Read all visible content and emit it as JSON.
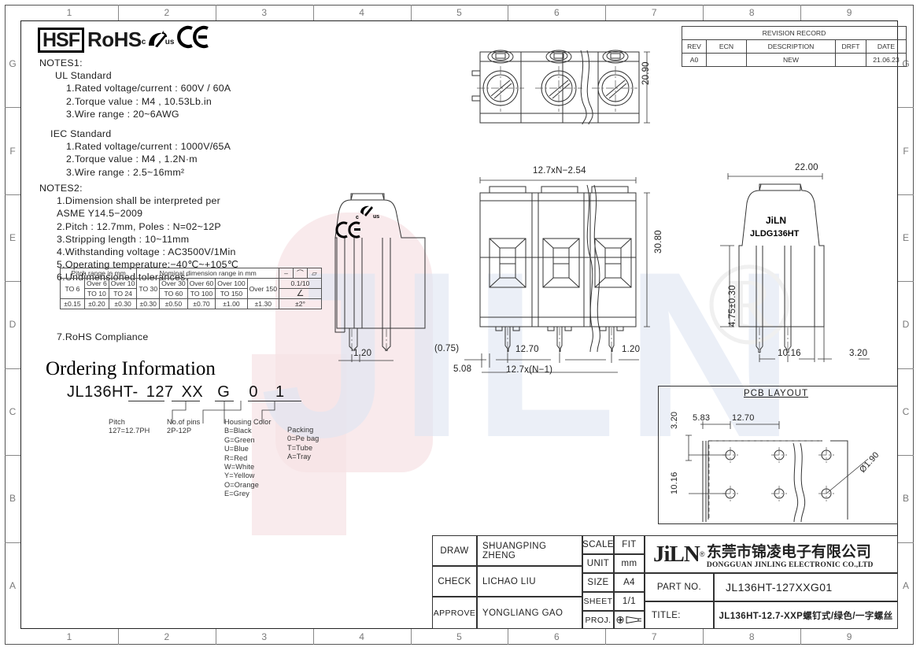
{
  "sheet": {
    "zones_top": [
      "1",
      "2",
      "3",
      "4",
      "5",
      "6",
      "7",
      "8",
      "9"
    ],
    "zones_bottom": [
      "1",
      "2",
      "3",
      "4",
      "5",
      "6",
      "7",
      "8",
      "9"
    ],
    "zones_left": [
      "G",
      "F",
      "E",
      "D",
      "C",
      "B",
      "A"
    ],
    "zones_right": [
      "G",
      "F",
      "E",
      "D",
      "C",
      "B",
      "A"
    ]
  },
  "compliance": {
    "hsf": "HSF",
    "rohs": "RoHS",
    "ul_c": "c",
    "ul_us": "us",
    "ce": "CE"
  },
  "notes1": {
    "heading": "NOTES1:",
    "groups": [
      {
        "title": "UL Standard",
        "items": [
          "1.Rated voltage/current : 600V / 60A",
          "2.Torque value : M4 , 10.53Lb.in",
          "3.Wire range : 20~6AWG"
        ]
      },
      {
        "title": "IEC Standard",
        "items": [
          "1.Rated voltage/current : 1000V/65A",
          "2.Torque value : M4 , 1.2N·m",
          "3.Wire range : 2.5~16mm²"
        ]
      }
    ]
  },
  "notes2": {
    "heading": "NOTES2:",
    "items": [
      "1.Dimension shall be interpreted per",
      "  ASME Y14.5−2009",
      "2.Pitch : 12.7mm, Poles : N=02~12P",
      "3.Stripping length : 10~11mm",
      "4.Withstanding voltage : AC3500V/1Min",
      "5.Operating temperature:−40℃~+105℃",
      "6.Undimensioned tolerances:"
    ],
    "item7": "7.RoHS Compliance"
  },
  "tolerance_table": {
    "header_pitch": "Pitch range in mm",
    "header_nominal": "Nominal dimension range in mm",
    "sym_dash": "–",
    "sym_arc": "⌒",
    "sym_par": "▱",
    "row2": [
      "",
      "Over 6",
      "Over 10",
      "",
      "Over 30",
      "Over 60",
      "Over 100",
      "Over 150"
    ],
    "row3": [
      "TO 6",
      "TO 10",
      "TO 24",
      "TO 30",
      "TO 60",
      "TO 100",
      "TO 150",
      ""
    ],
    "row4": [
      "±0.15",
      "±0.20",
      "±0.30",
      "±0.30",
      "±0.50",
      "±0.70",
      "±1.00",
      "±1.30"
    ],
    "right_top": "0.1/10",
    "right_mid": "∠",
    "right_bot": "±2°"
  },
  "ordering": {
    "title": "Ordering Information",
    "code_parts": [
      "JL136HT-",
      "127",
      "XX",
      "G",
      "0",
      "1"
    ],
    "legends": [
      {
        "name": "pitch",
        "lines": [
          "Pitch",
          "127=12.7PH"
        ]
      },
      {
        "name": "pins",
        "lines": [
          "No.of  pins",
          "2P-12P"
        ]
      },
      {
        "name": "housing-color",
        "lines": [
          "Housing Color",
          "B=Black",
          "G=Green",
          "U=Blue",
          "R=Red",
          "W=White",
          "Y=Yellow",
          "O=Orange",
          "E=Grey"
        ]
      },
      {
        "name": "packing",
        "lines": [
          "Packing",
          "0=Pe bag",
          "T=Tube",
          "A=Tray"
        ]
      }
    ]
  },
  "revision": {
    "title": "REVISION RECORD",
    "columns": [
      "REV",
      "ECN",
      "DESCRIPTION",
      "DRFT",
      "DATE"
    ],
    "rows": [
      [
        "A0",
        "",
        "NEW",
        "",
        "21.06.23"
      ]
    ]
  },
  "views": {
    "top_view": {
      "height_dim": "20.90"
    },
    "front_view": {
      "width_dim": "12.7xN−2.54",
      "height_dim": "30.80",
      "d_075": "(0.75)",
      "d_508": "5.08",
      "d_1270": "12.70",
      "d_pitch_n": "12.7x(N−1)",
      "d_120": "1.20"
    },
    "side_view_left": {
      "d_120": "1.20"
    },
    "side_view_right": {
      "width_dim": "22.00",
      "brand": "JiLN",
      "model": "JLDG136HT",
      "pin_len": "4.75±0.30",
      "d_1016": "10.16",
      "d_320": "3.20"
    },
    "pcb_layout": {
      "title": "PCB LAYOUT",
      "d_320": "3.20",
      "d_583": "5.83",
      "d_1270": "12.70",
      "d_1016": "10.16",
      "hole_dia": "Ø1.90"
    }
  },
  "title_block": {
    "draw_label": "DRAW",
    "draw_value": "SHUANGPING ZHENG",
    "check_label": "CHECK",
    "check_value": "LICHAO   LIU",
    "approve_label": "APPROVE",
    "approve_value": "YONGLIANG GAO",
    "scale_label": "SCALE",
    "scale_value": "FIT",
    "unit_label": "UNIT",
    "unit_value": "mm",
    "size_label": "SIZE",
    "size_value": "A4",
    "sheet_label": "SHEET",
    "sheet_value": "1/1",
    "proj_label": "PROJ.",
    "company_logo": "JiLN",
    "company_reg": "®",
    "company_cn": "东莞市锦凌电子有限公司",
    "company_en": "DONGGUAN JINLING ELECTRONIC CO.,LTD",
    "partno_label": "PART NO.",
    "partno_value": "JL136HT-127XXG01",
    "title_label": "TITLE:",
    "title_value": "JL136HT-12.7-XXP螺钉式/绿色/一字螺丝"
  }
}
